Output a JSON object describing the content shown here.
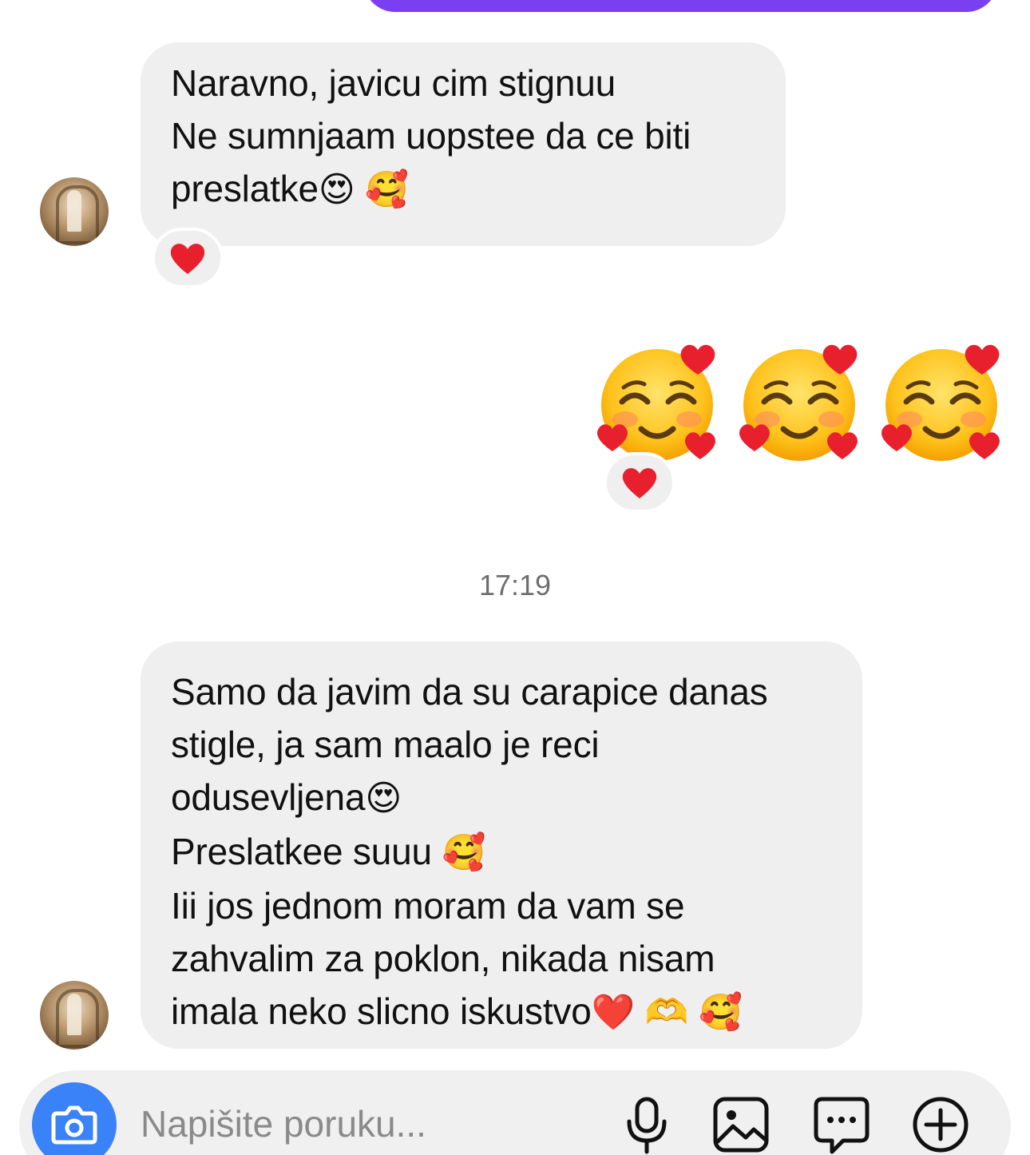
{
  "thread": {
    "messages": [
      {
        "lines": [
          "Naravno, javicu cim stignuu",
          "Ne sumnjaam uopstee da ce biti",
          "preslatke"
        ],
        "line3_emojis": [
          "😍",
          "🥰"
        ],
        "reaction": "❤️"
      },
      {
        "emoji_message": [
          "🥰",
          "🥰",
          "🥰"
        ],
        "reaction": "❤️"
      },
      {
        "lines": [
          "Samo da javim da su carapice danas",
          "stigle, ja sam maalo je reci",
          "odusevljena",
          "Preslatkee suuu",
          "Iii jos jednom moram da vam se",
          "zahvalim za poklon, nikada nisam",
          "imala neko slicno iskustvo"
        ],
        "line3_emojis": [
          "😍"
        ],
        "line4_emojis": [
          "🥰"
        ],
        "line7_emojis": [
          "❤️",
          "🫶",
          "🥰"
        ]
      }
    ],
    "timestamp": "17:19"
  },
  "composer": {
    "placeholder": "Napišite poruku...",
    "icons": [
      "camera-icon",
      "microphone-icon",
      "gallery-icon",
      "sticker-chat-icon",
      "add-icon"
    ],
    "camera_color": "#3a82f7"
  },
  "colors": {
    "sent_bubble": "#7b3ff2",
    "received_bubble": "#efefef"
  }
}
